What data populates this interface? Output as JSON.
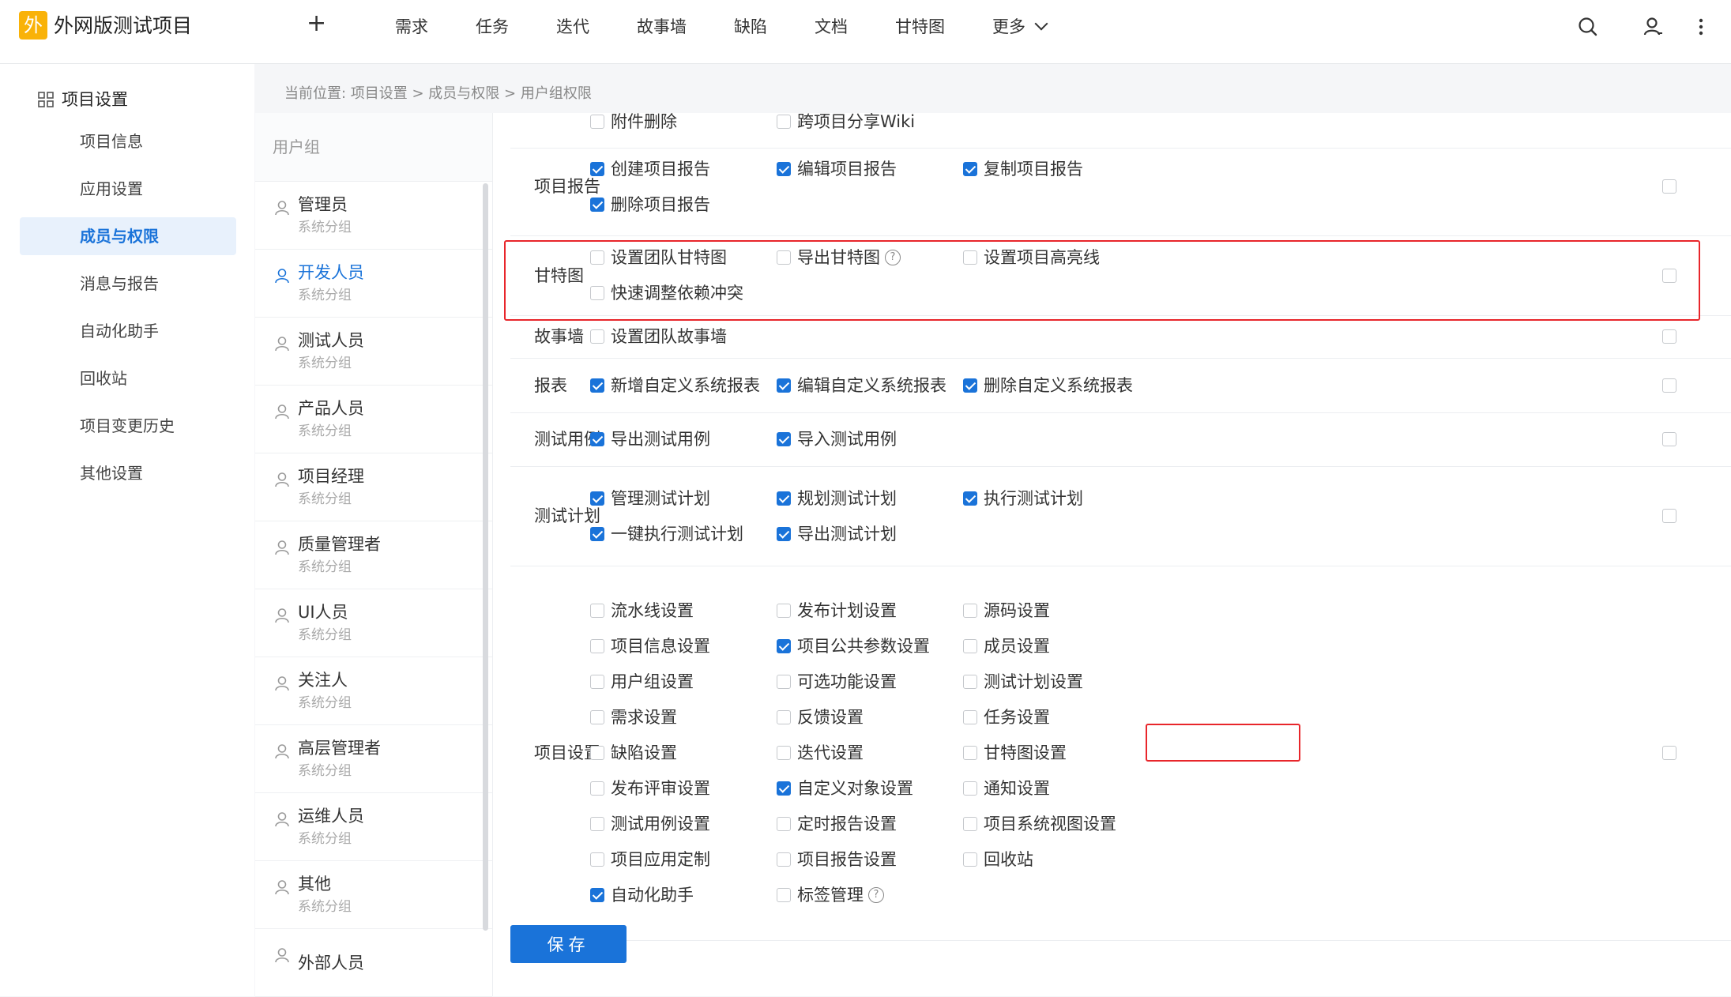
{
  "app": {
    "logo_char": "外",
    "project_title": "外网版测试项目",
    "plus": "+"
  },
  "nav": {
    "items": [
      "需求",
      "任务",
      "迭代",
      "故事墙",
      "缺陷",
      "文档",
      "甘特图"
    ],
    "more": "更多"
  },
  "sidebar": {
    "header": "项目设置",
    "items": [
      "项目信息",
      "应用设置",
      "成员与权限",
      "消息与报告",
      "自动化助手",
      "回收站",
      "项目变更历史",
      "其他设置"
    ],
    "active_index": 2
  },
  "breadcrumb": "当前位置:  项目设置 > 成员与权限 > 用户组权限",
  "groups": {
    "header": "用户组",
    "items": [
      {
        "name": "管理员",
        "sub": "系统分组"
      },
      {
        "name": "开发人员",
        "sub": "系统分组"
      },
      {
        "name": "测试人员",
        "sub": "系统分组"
      },
      {
        "name": "产品人员",
        "sub": "系统分组"
      },
      {
        "name": "项目经理",
        "sub": "系统分组"
      },
      {
        "name": "质量管理者",
        "sub": "系统分组"
      },
      {
        "name": "UI人员",
        "sub": "系统分组"
      },
      {
        "name": "关注人",
        "sub": "系统分组"
      },
      {
        "name": "高层管理者",
        "sub": "系统分组"
      },
      {
        "name": "运维人员",
        "sub": "系统分组"
      },
      {
        "name": "其他",
        "sub": "系统分组"
      },
      {
        "name": "外部人员",
        "sub": ""
      }
    ],
    "active_index": 1
  },
  "permissions": {
    "partial_row": [
      {
        "label": "附件删除",
        "checked": false
      },
      {
        "label": "跨项目分享Wiki",
        "checked": false
      }
    ],
    "sections": [
      {
        "label": "项目报告",
        "perms": [
          {
            "label": "创建项目报告",
            "checked": true
          },
          {
            "label": "编辑项目报告",
            "checked": true
          },
          {
            "label": "复制项目报告",
            "checked": true
          },
          {
            "label": "删除项目报告",
            "checked": true
          }
        ]
      },
      {
        "label": "甘特图",
        "perms": [
          {
            "label": "设置团队甘特图",
            "checked": false
          },
          {
            "label": "导出甘特图",
            "checked": false,
            "help": "?"
          },
          {
            "label": "设置项目高亮线",
            "checked": false
          },
          {
            "label": "快速调整依赖冲突",
            "checked": false
          }
        ]
      },
      {
        "label": "故事墙",
        "perms": [
          {
            "label": "设置团队故事墙",
            "checked": false
          }
        ]
      },
      {
        "label": "报表",
        "perms": [
          {
            "label": "新增自定义系统报表",
            "checked": true
          },
          {
            "label": "编辑自定义系统报表",
            "checked": true
          },
          {
            "label": "删除自定义系统报表",
            "checked": true
          }
        ]
      },
      {
        "label": "测试用例",
        "perms": [
          {
            "label": "导出测试用例",
            "checked": true
          },
          {
            "label": "导入测试用例",
            "checked": true
          }
        ]
      },
      {
        "label": "测试计划",
        "perms": [
          {
            "label": "管理测试计划",
            "checked": true
          },
          {
            "label": "规划测试计划",
            "checked": true
          },
          {
            "label": "执行测试计划",
            "checked": true
          },
          {
            "label": "一键执行测试计划",
            "checked": true
          },
          {
            "label": "导出测试计划",
            "checked": true
          }
        ]
      },
      {
        "label": "项目设置",
        "perms": [
          {
            "label": "流水线设置",
            "checked": false
          },
          {
            "label": "发布计划设置",
            "checked": false
          },
          {
            "label": "源码设置",
            "checked": false
          },
          {
            "label": "项目信息设置",
            "checked": false
          },
          {
            "label": "项目公共参数设置",
            "checked": true
          },
          {
            "label": "成员设置",
            "checked": false
          },
          {
            "label": "用户组设置",
            "checked": false
          },
          {
            "label": "可选功能设置",
            "checked": false
          },
          {
            "label": "测试计划设置",
            "checked": false
          },
          {
            "label": "需求设置",
            "checked": false
          },
          {
            "label": "反馈设置",
            "checked": false
          },
          {
            "label": "任务设置",
            "checked": false
          },
          {
            "label": "缺陷设置",
            "checked": false
          },
          {
            "label": "迭代设置",
            "checked": false
          },
          {
            "label": "甘特图设置",
            "checked": false
          },
          {
            "label": "发布评审设置",
            "checked": false
          },
          {
            "label": "自定义对象设置",
            "checked": true
          },
          {
            "label": "通知设置",
            "checked": false
          },
          {
            "label": "测试用例设置",
            "checked": false
          },
          {
            "label": "定时报告设置",
            "checked": false
          },
          {
            "label": "项目系统视图设置",
            "checked": false
          },
          {
            "label": "项目应用定制",
            "checked": false
          },
          {
            "label": "项目报告设置",
            "checked": false
          },
          {
            "label": "回收站",
            "checked": false
          },
          {
            "label": "自动化助手",
            "checked": true
          },
          {
            "label": "标签管理",
            "checked": false,
            "help": "?"
          }
        ]
      }
    ]
  },
  "save_label": "保存",
  "colors": {
    "accent": "#1a73d9",
    "highlight_box": "#e8262b",
    "logo": "#f9b208"
  }
}
